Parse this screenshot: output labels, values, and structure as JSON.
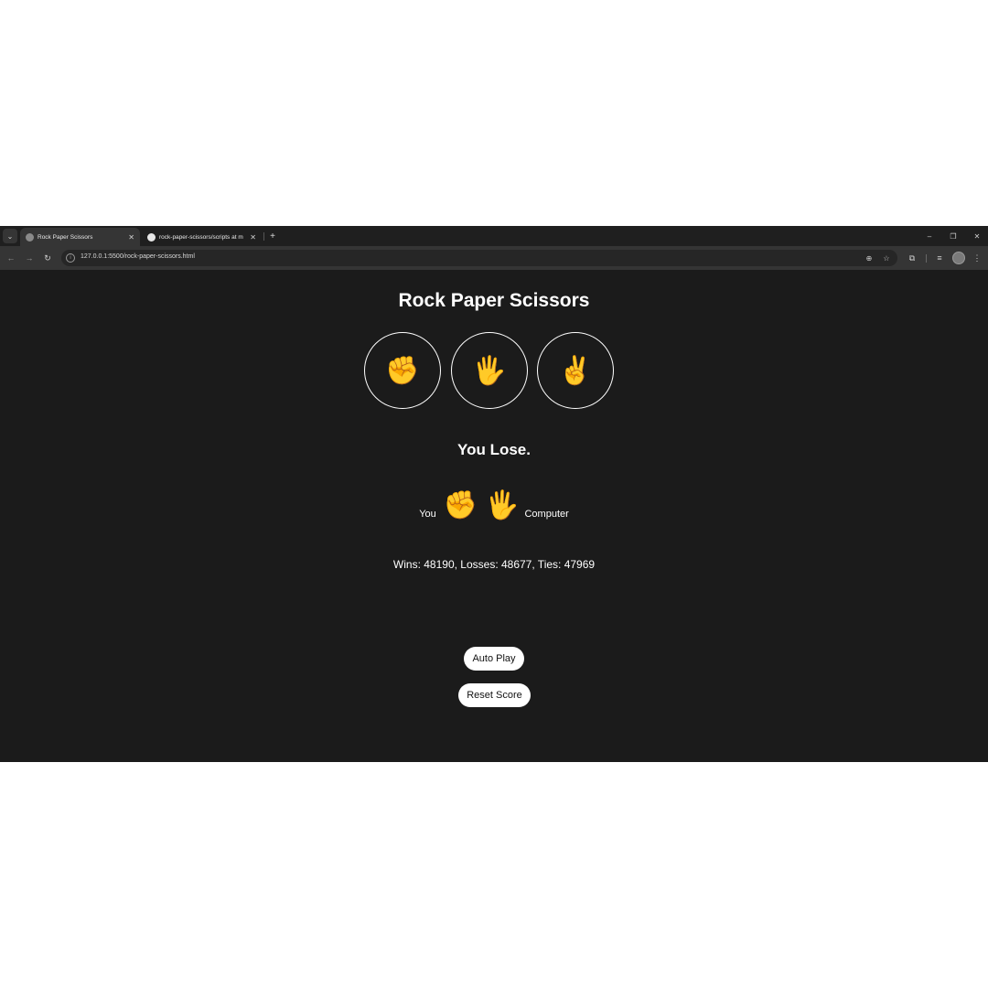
{
  "browser": {
    "tabs": [
      {
        "title": "Rock Paper Scissors",
        "active": true
      },
      {
        "title": "rock-paper-scissors/scripts at m",
        "active": false
      }
    ],
    "new_tab": "+",
    "window_controls": {
      "minimize": "–",
      "restore": "❐",
      "close": "✕"
    },
    "toolbar": {
      "back": "←",
      "forward": "→",
      "reload": "↻",
      "url": "127.0.0.1:5500/rock-paper-scissors.html"
    }
  },
  "page": {
    "title": "Rock Paper Scissors",
    "moves": [
      {
        "name": "rock",
        "emoji": "✊"
      },
      {
        "name": "paper",
        "emoji": "🖐"
      },
      {
        "name": "scissors",
        "emoji": "✌"
      }
    ],
    "result": "You Lose.",
    "last_round": {
      "you_label": "You",
      "player_emoji": "✊",
      "computer_emoji": "🖐",
      "computer_label": "Computer"
    },
    "score_text": "Wins: 48190, Losses: 48677, Ties: 47969",
    "score": {
      "wins": 48190,
      "losses": 48677,
      "ties": 47969
    },
    "buttons": {
      "auto_play": "Auto Play",
      "reset_score": "Reset Score"
    }
  },
  "icons": [
    "search-tabs-icon",
    "globe-icon",
    "github-icon",
    "close-icon",
    "back-icon",
    "forward-icon",
    "reload-icon",
    "site-info-icon",
    "zoom-icon",
    "star-icon",
    "extensions-icon",
    "reading-list-icon",
    "menu-icon"
  ],
  "colors": {
    "page_bg": "#1b1b1b",
    "text": "#ffffff",
    "pill_bg": "#ffffff",
    "emoji_yellow": "#f5c33b"
  }
}
